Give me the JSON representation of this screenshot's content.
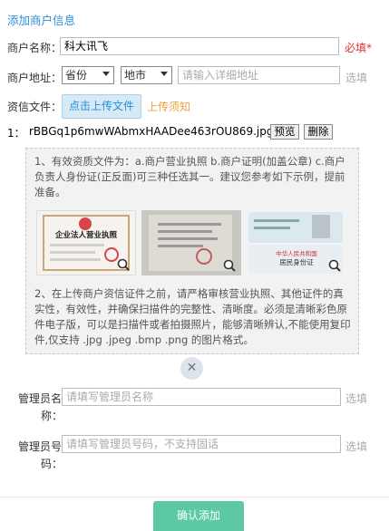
{
  "page": {
    "title": "添加商户信息"
  },
  "form": {
    "merchant_name": {
      "label": "商户名称：",
      "value": "科大讯飞",
      "required_note": "必填*"
    },
    "merchant_address": {
      "label": "商户地址：",
      "province": "省份",
      "city": "地市",
      "detail_placeholder": "请输入详细地址",
      "optional_note": "选填"
    },
    "qualification": {
      "label": "资信文件：",
      "upload_button": "点击上传文件",
      "upload_hint": "上传须知"
    },
    "file_row": {
      "index": "1：",
      "filename": "rBBGq1p6mwWAbmxHAADee463rOU869.jpg",
      "preview_button": "预览",
      "delete_button": "删除"
    },
    "notice": {
      "para1": "1、有效资质文件为：a.商户营业执照 b.商户证明(加盖公章) c.商户负责人身份证(正反面)可三种任选其一。建议您参考如下示例，提前准备。",
      "para2": "2、在上传商户资信证件之前，请严格审核营业执照、其他证件的真实性，有效性，并确保扫描件的完整性、清晰度。必须是清晰彩色原件电子版，可以是扫描件或者拍摄照片，能够清晰辨认,不能使用复印件,仅支持 .jpg .jpeg .bmp .png 的图片格式。",
      "thumb_license_title": "企业法人营业执照",
      "thumb_id_title": "中华人民共和国",
      "thumb_id_subtitle": "居民身份证"
    },
    "admin_name": {
      "label_line1": "管理员名",
      "label_line2": "称：",
      "placeholder": "请填写管理员名称",
      "optional_note": "选填"
    },
    "admin_phone": {
      "label_line1": "管理员号",
      "label_line2": "码：",
      "placeholder": "请填写管理员号码，不支持固话",
      "optional_note": "选填"
    },
    "confirm_button": "确认添加"
  },
  "colors": {
    "accent": "#2a8fd6",
    "required": "#e03333",
    "confirm": "#5dc8a4"
  },
  "icons": [
    "magnifier-icon",
    "close-icon",
    "chevron-down-icon"
  ]
}
